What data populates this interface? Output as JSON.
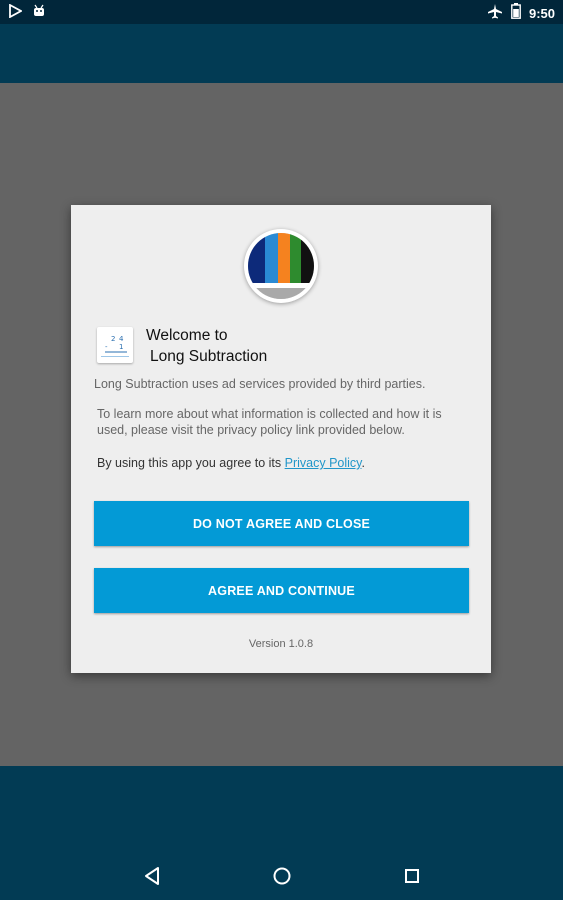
{
  "status_bar": {
    "time": "9:50",
    "left_icons": [
      "play-store-icon",
      "android-icon"
    ],
    "right_icons": [
      "airplane-icon",
      "battery-icon"
    ]
  },
  "dialog": {
    "welcome_line1": "Welcome to",
    "welcome_line2": "Long Subtraction",
    "para1": "Long Subtraction uses ad services provided by third parties.",
    "para2": "To learn more about what information is collected and how it is used, please visit the privacy policy link provided below.",
    "para3_prefix": "By using this app you agree to its ",
    "privacy_link": "Privacy Policy",
    "para3_suffix": ".",
    "button_disagree": "DO NOT AGREE AND CLOSE",
    "button_agree": "AGREE AND CONTINUE",
    "version": "Version 1.0.8"
  },
  "colors": {
    "app_bar": "#023b54",
    "status_bar": "#01263a",
    "button": "#039ad6",
    "link": "#2196c9"
  },
  "nav": [
    "back-icon",
    "home-icon",
    "recents-icon"
  ]
}
